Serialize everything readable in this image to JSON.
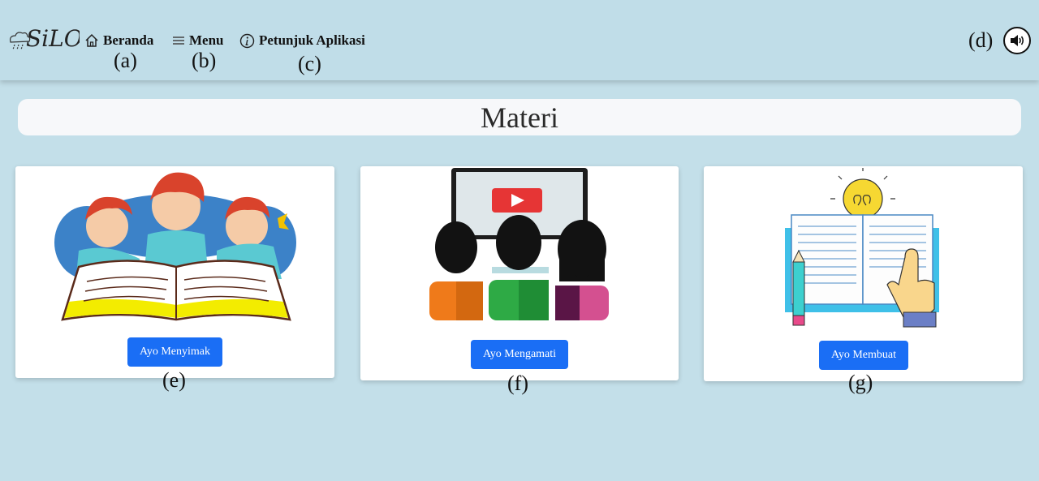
{
  "nav": {
    "logo_text": "SiLO",
    "home_label": "Beranda",
    "menu_label": "Menu",
    "guide_label": "Petunjuk Aplikasi",
    "home_icon": "home-icon",
    "menu_icon": "hamburger-icon",
    "guide_icon": "info-icon",
    "sound_icon": "speaker-icon"
  },
  "annotations": {
    "a": "(a)",
    "b": "(b)",
    "c": "(c)",
    "d": "(d)",
    "e": "(e)",
    "f": "(f)",
    "g": "(g)"
  },
  "page_title": "Materi",
  "cards": [
    {
      "button_label": "Ayo Menyimak",
      "illustration": "children-reading-book"
    },
    {
      "button_label": "Ayo Mengamati",
      "illustration": "people-watching-video"
    },
    {
      "button_label": "Ayo Membuat",
      "illustration": "book-lightbulb-pencil"
    }
  ],
  "colors": {
    "background": "#c3dfe9",
    "button": "#1a6ef5",
    "title_bar": "#f7f8fa"
  }
}
